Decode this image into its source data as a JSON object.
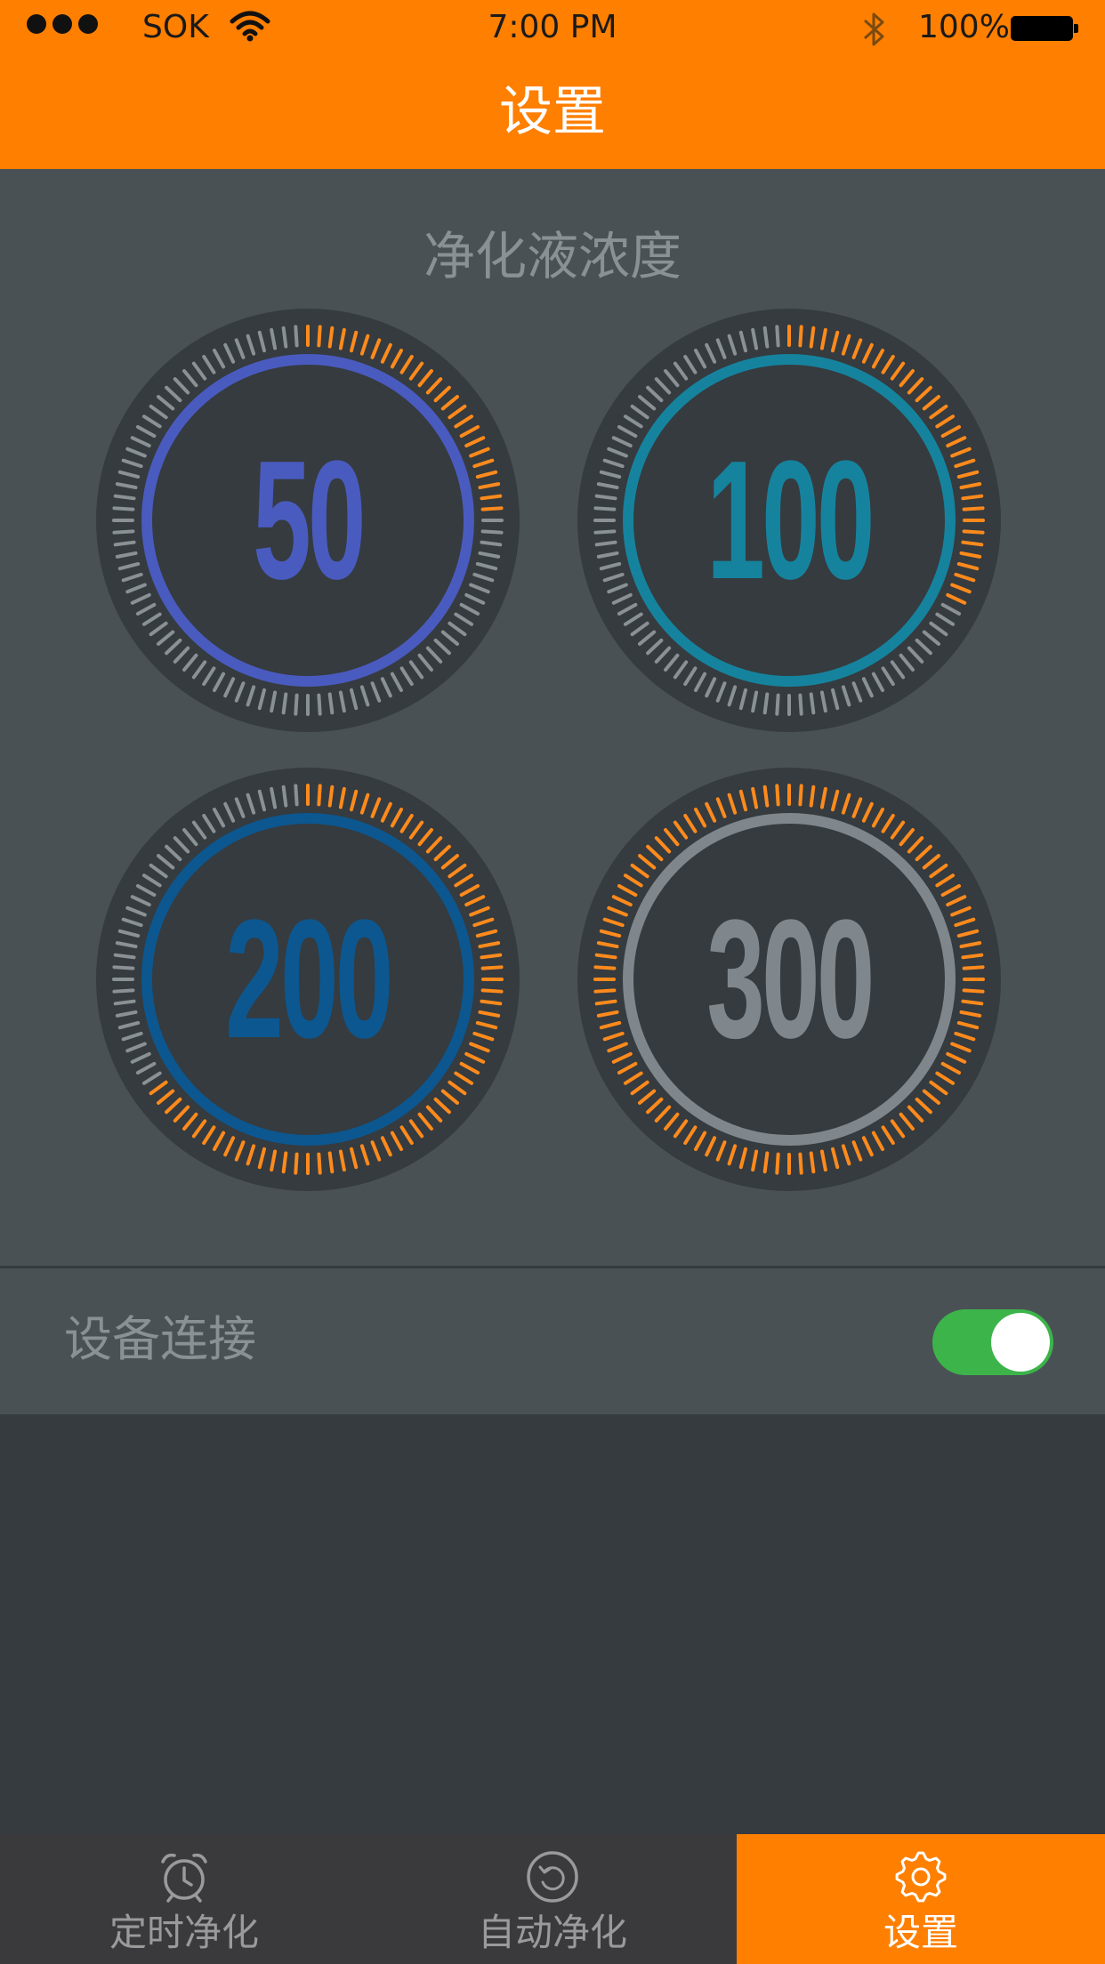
{
  "status_bar": {
    "carrier": "SOK",
    "time": "7:00 PM",
    "battery": "100%"
  },
  "nav": {
    "title": "设置"
  },
  "concentration": {
    "title": "净化液浓度",
    "dials": [
      {
        "value": "50",
        "color": "#4a5bbf",
        "level": 0.25
      },
      {
        "value": "100",
        "color": "#16839e",
        "level": 0.33
      },
      {
        "value": "200",
        "color": "#0c5790",
        "level": 0.66
      },
      {
        "value": "300",
        "color": "#7f878d",
        "level": 1.0
      }
    ],
    "tick_color": "#8a9195",
    "active_tick_color": "#ff8a1c"
  },
  "device_connection": {
    "label": "设备连接",
    "enabled": true,
    "color": "#3cb44a"
  },
  "tabbar": {
    "tabs": [
      {
        "label": "定时净化",
        "icon": "alarm-clock-icon"
      },
      {
        "label": "自动净化",
        "icon": "refresh-icon"
      },
      {
        "label": "设置",
        "icon": "gear-icon",
        "active": true
      }
    ]
  },
  "colors": {
    "accent": "#ff7f00",
    "panel": "#4a5155",
    "background": "#353b3f"
  }
}
